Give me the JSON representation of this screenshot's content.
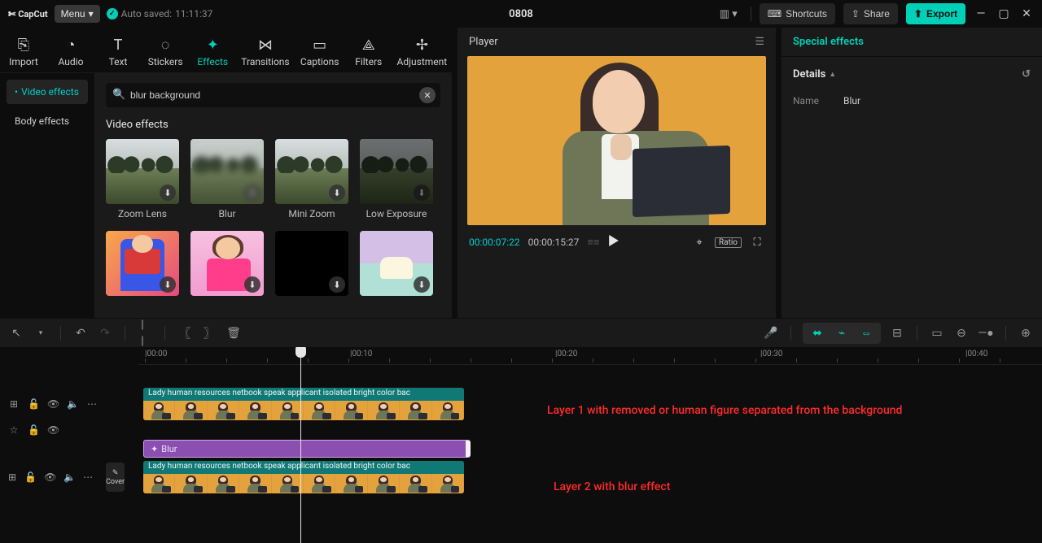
{
  "titlebar": {
    "app": "CapCut",
    "menu": "Menu",
    "autosaved_prefix": "Auto saved:",
    "autosaved_time": "11:11:37",
    "project": "0808",
    "shortcuts": "Shortcuts",
    "share": "Share",
    "export": "Export"
  },
  "tabs": [
    {
      "label": "Import",
      "icon": "⎘"
    },
    {
      "label": "Audio",
      "icon": "◔"
    },
    {
      "label": "Text",
      "icon": "T"
    },
    {
      "label": "Stickers",
      "icon": "◌"
    },
    {
      "label": "Effects",
      "icon": "✦",
      "active": true
    },
    {
      "label": "Transitions",
      "icon": "⋈"
    },
    {
      "label": "Captions",
      "icon": "▭"
    },
    {
      "label": "Filters",
      "icon": "⟁"
    },
    {
      "label": "Adjustment",
      "icon": "✢"
    }
  ],
  "sub_sidebar": [
    {
      "label": "Video effects",
      "active": true
    },
    {
      "label": "Body effects"
    }
  ],
  "search": {
    "value": "blur background"
  },
  "effects": {
    "section": "Video effects",
    "items": [
      {
        "label": "Zoom Lens",
        "variant": "landscape"
      },
      {
        "label": "Blur",
        "variant": "landscape blurv"
      },
      {
        "label": "Mini Zoom",
        "variant": "landscape"
      },
      {
        "label": "Low Exposure",
        "variant": "landscape dark"
      },
      {
        "label": "",
        "variant": "person1"
      },
      {
        "label": "",
        "variant": "person2"
      },
      {
        "label": "",
        "variant": "blackt"
      },
      {
        "label": "",
        "variant": "car"
      }
    ]
  },
  "player": {
    "title": "Player",
    "current": "00:00:07:22",
    "duration": "00:00:15:27",
    "ratio": "Ratio"
  },
  "right": {
    "title": "Special effects",
    "details": "Details",
    "name_label": "Name",
    "name_value": "Blur"
  },
  "timeline": {
    "ruler": [
      "|00:00",
      "|00:10",
      "|00:20",
      "|00:30",
      "|00:40"
    ],
    "clip_label": "Lady human resources netbook speak applicant isolated bright color bac",
    "fx_label": "Blur",
    "cover": "Cover"
  },
  "annotations": {
    "layer1": "Layer 1 with removed or human figure separated from the background",
    "layer2": "Layer 2 with blur effect"
  }
}
